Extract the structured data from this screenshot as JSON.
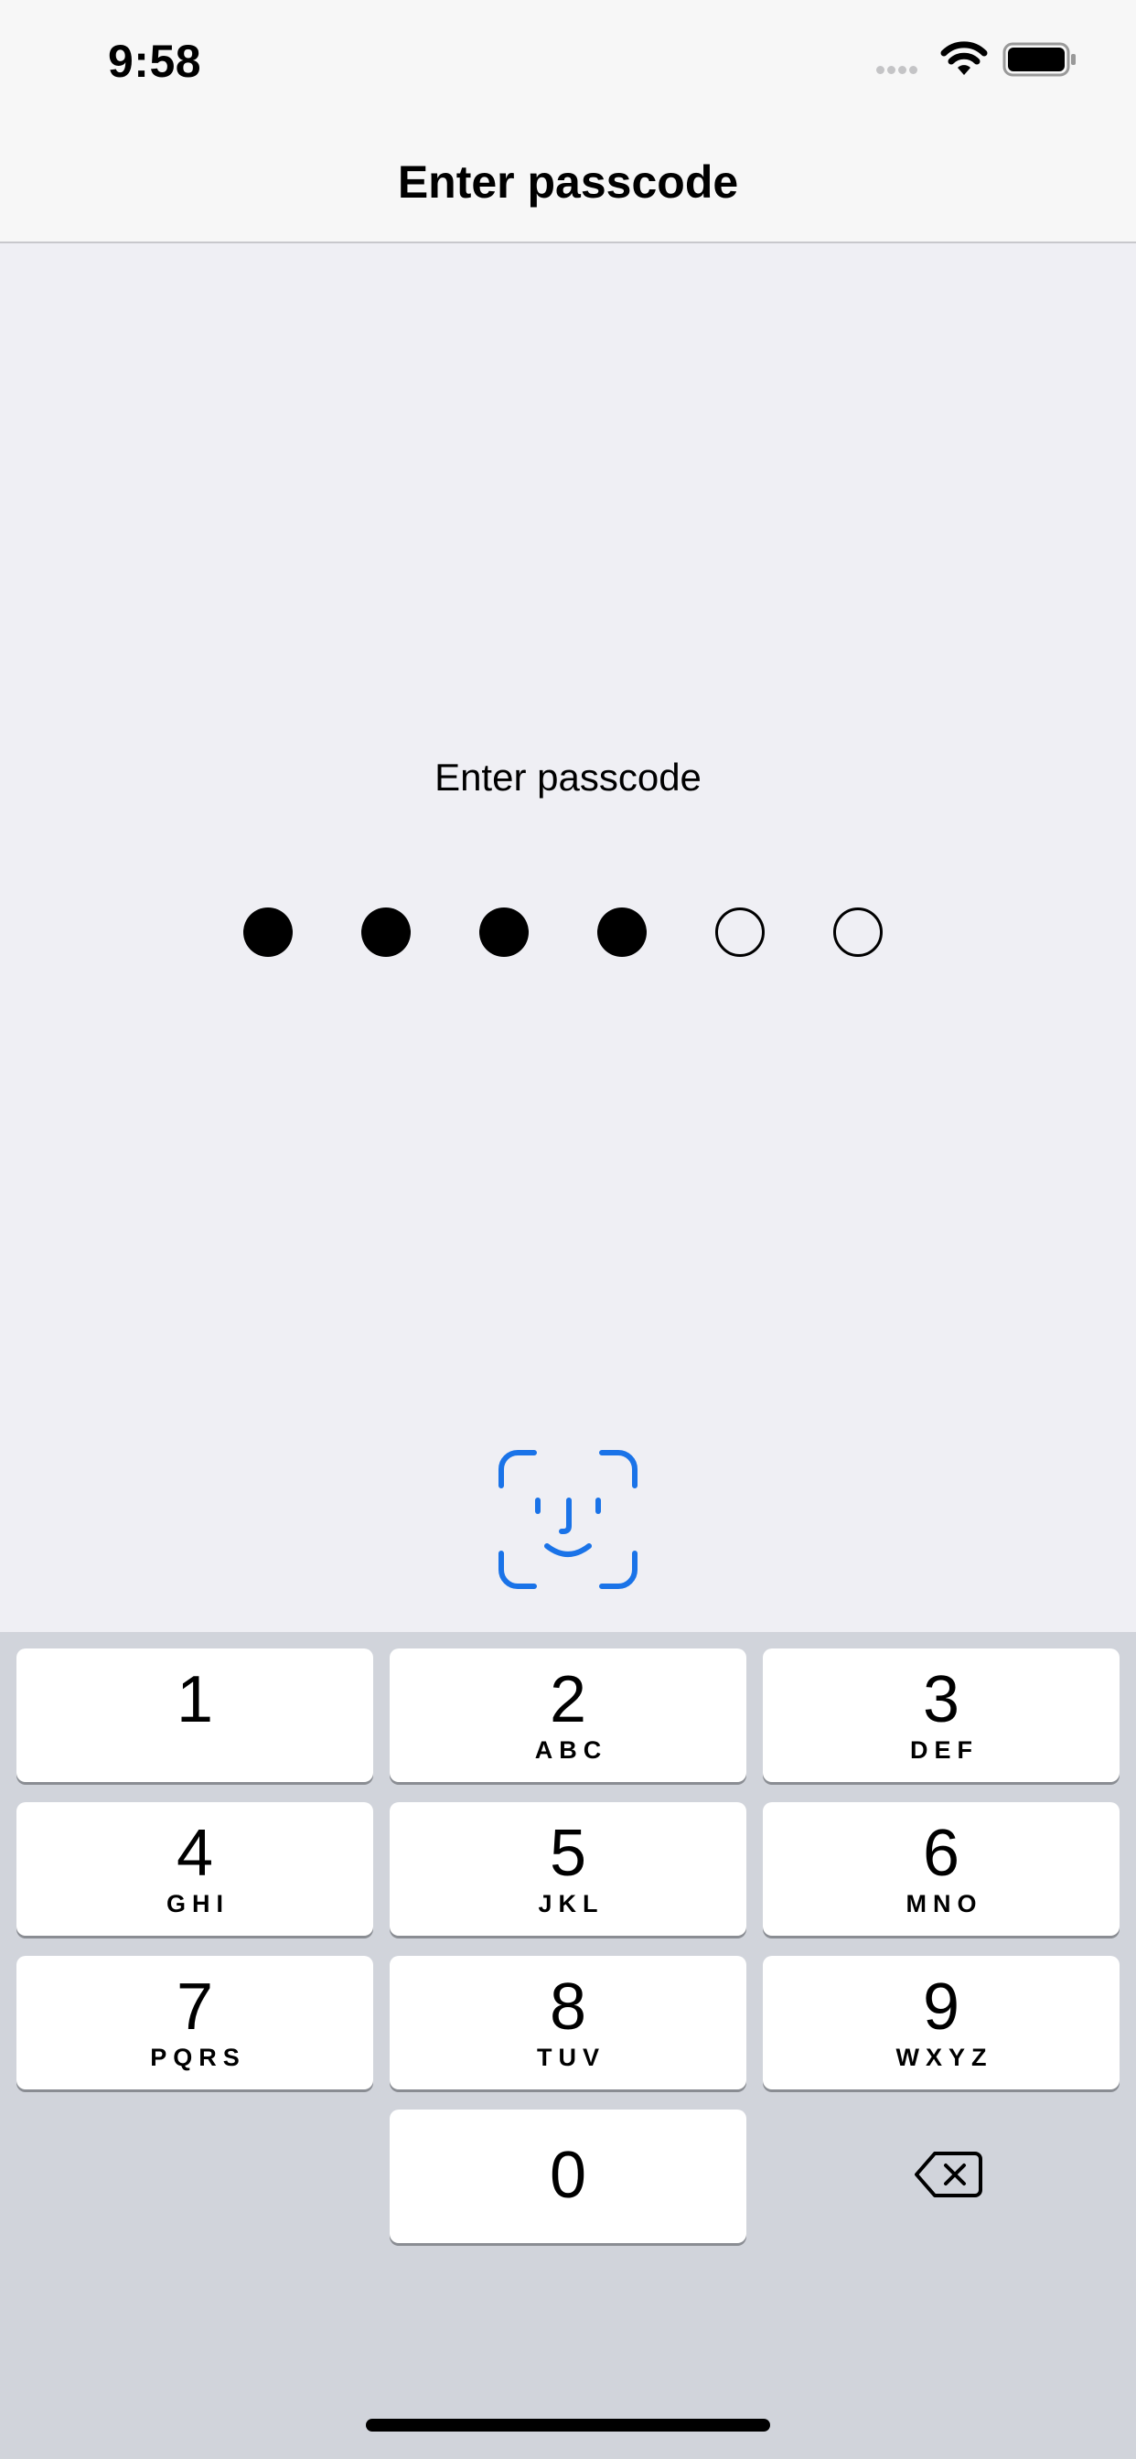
{
  "status_bar": {
    "time": "9:58",
    "signal_icon": "cellular-signal-icon",
    "wifi_icon": "wifi-icon",
    "battery_icon": "battery-icon"
  },
  "nav": {
    "title": "Enter passcode"
  },
  "passcode": {
    "prompt": "Enter passcode",
    "length": 6,
    "entered": 4
  },
  "face_id": {
    "icon": "face-id-icon",
    "color": "#1a73e8"
  },
  "keypad": {
    "keys": [
      {
        "digit": "1",
        "letters": ""
      },
      {
        "digit": "2",
        "letters": "ABC"
      },
      {
        "digit": "3",
        "letters": "DEF"
      },
      {
        "digit": "4",
        "letters": "GHI"
      },
      {
        "digit": "5",
        "letters": "JKL"
      },
      {
        "digit": "6",
        "letters": "MNO"
      },
      {
        "digit": "7",
        "letters": "PQRS"
      },
      {
        "digit": "8",
        "letters": "TUV"
      },
      {
        "digit": "9",
        "letters": "WXYZ"
      },
      {
        "digit": "0",
        "letters": ""
      }
    ],
    "delete_icon": "delete-backspace-icon"
  }
}
